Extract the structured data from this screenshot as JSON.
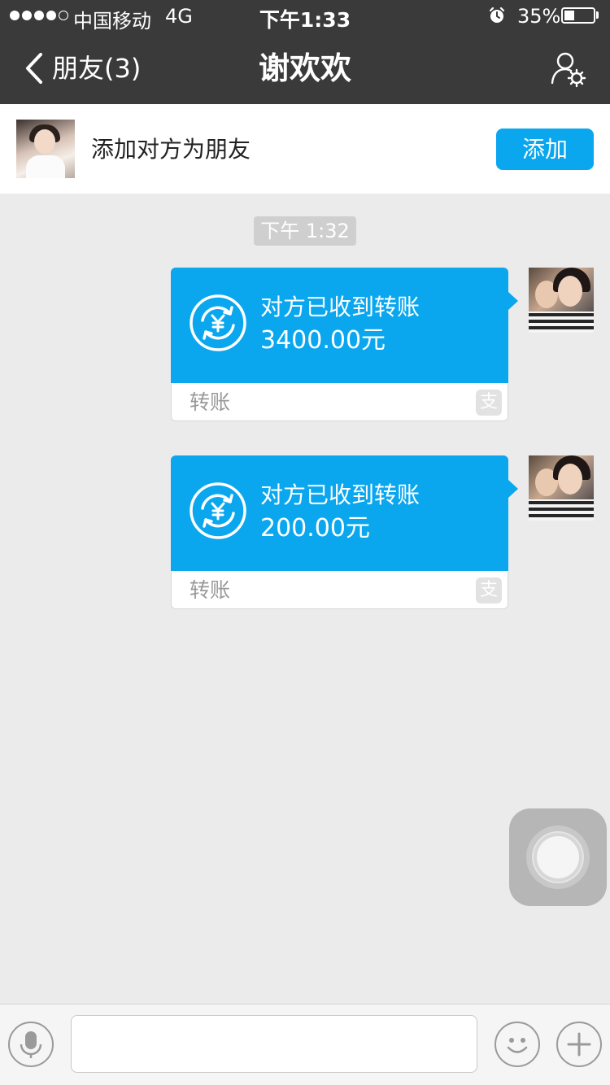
{
  "status_bar": {
    "carrier": "中国移动",
    "network": "4G",
    "time": "下午1:33",
    "battery_percent": "35%",
    "battery_level": 0.35,
    "signal_bars_filled": 4,
    "signal_bars_total": 5
  },
  "nav": {
    "back_label": "朋友(3)",
    "title": "谢欢欢",
    "back_icon": "chevron-left-icon",
    "right_icon": "profile-settings-icon"
  },
  "banner": {
    "text": "添加对方为朋友",
    "add_button_label": "添加"
  },
  "chat": {
    "timestamp": "下午 1:32",
    "messages": [
      {
        "status": "对方已收到转账",
        "amount": "3400.00元",
        "label": "转账",
        "brand_icon_glyph": "支"
      },
      {
        "status": "对方已收到转账",
        "amount": "200.00元",
        "label": "转账",
        "brand_icon_glyph": "支"
      }
    ]
  },
  "input_bar": {
    "message_value": "",
    "icons": [
      "microphone-icon",
      "emoji-icon",
      "plus-icon"
    ]
  },
  "colors": {
    "nav_background": "#3a3a3a",
    "accent": "#0aa7ef",
    "chat_background": "#ebebeb"
  }
}
